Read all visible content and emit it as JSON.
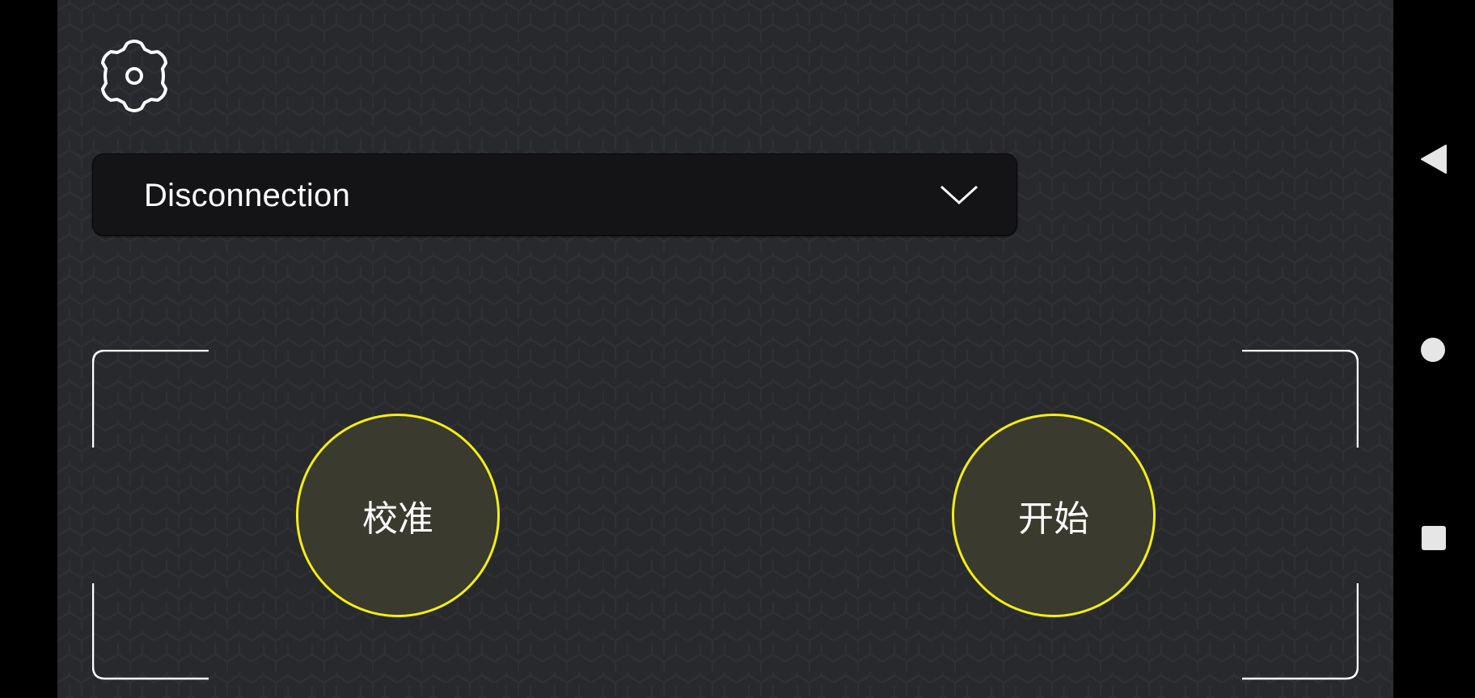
{
  "connection": {
    "selected": "Disconnection"
  },
  "buttons": {
    "calibrate_label": "校准",
    "start_label": "开始"
  },
  "icons": {
    "settings": "gear-icon",
    "dropdown": "chevron-down-icon",
    "nav_back": "back-triangle-icon",
    "nav_home": "home-circle-icon",
    "nav_recents": "recents-square-icon"
  },
  "colors": {
    "background": "#28292d",
    "accent": "#f3ef0f",
    "dropdown_bg": "#141416",
    "text": "#ffffff",
    "navbar": "#000000"
  }
}
